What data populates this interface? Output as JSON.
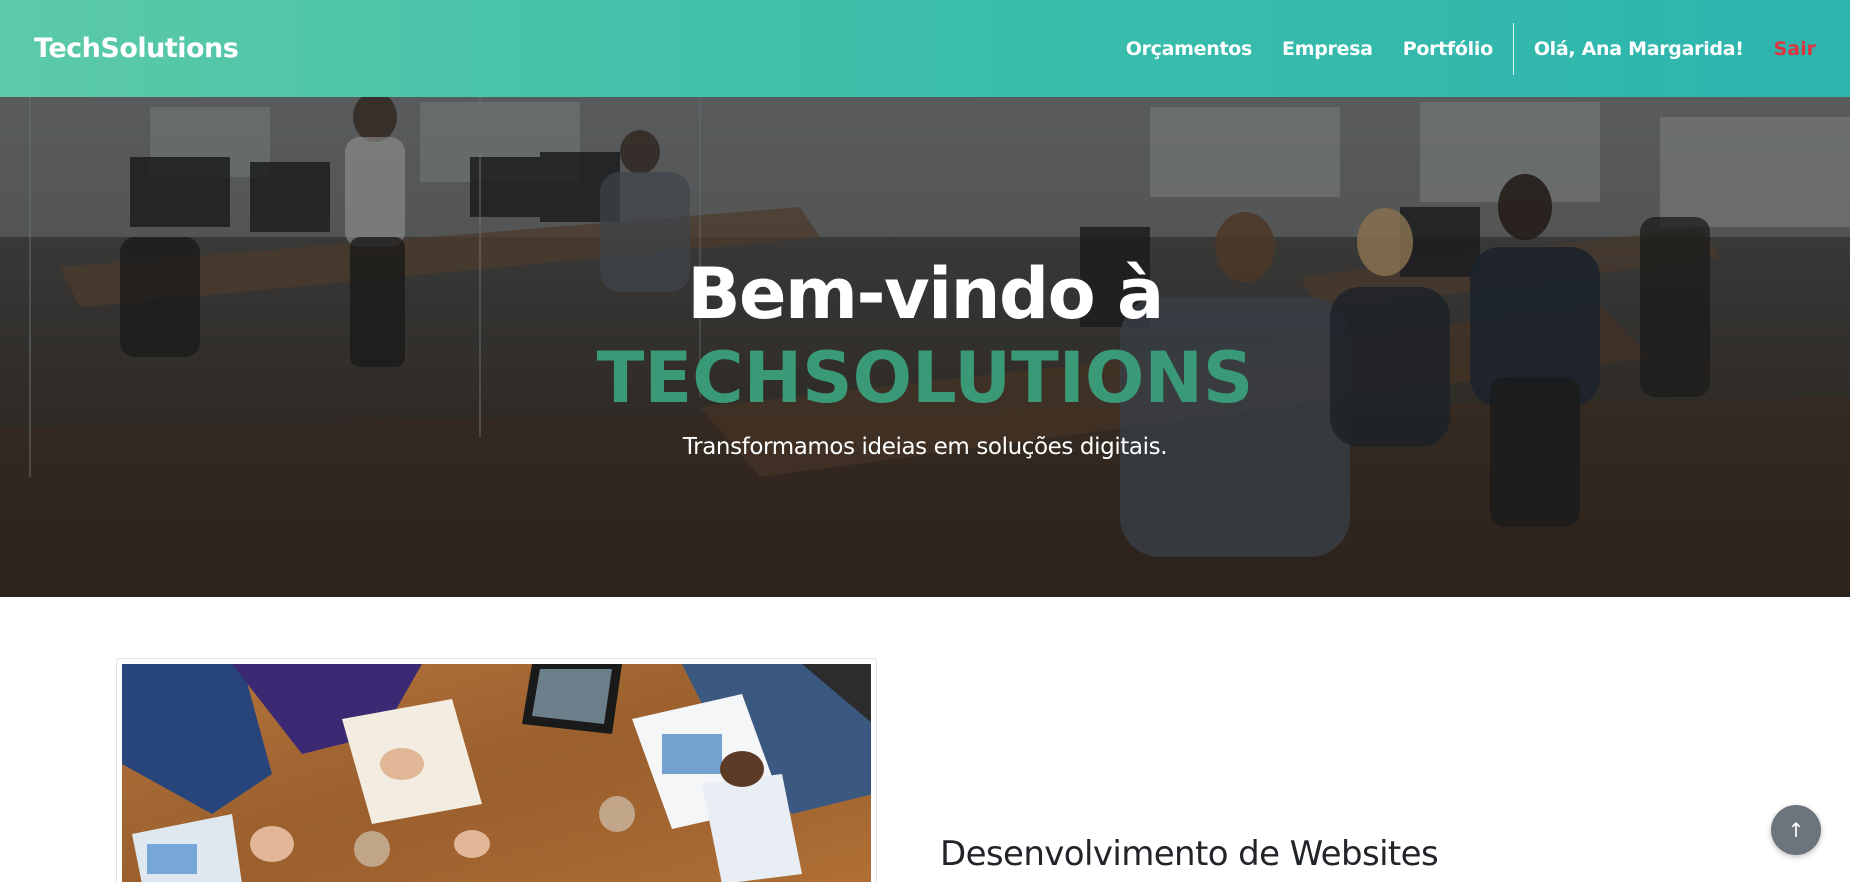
{
  "navbar": {
    "brand": "TechSolutions",
    "links": [
      {
        "label": "Orçamentos"
      },
      {
        "label": "Empresa"
      },
      {
        "label": "Portfólio"
      }
    ],
    "greeting": "Olá, Ana Margarida!",
    "logout": "Sair",
    "logout_color": "#e0323f",
    "gradient": [
      "#5ccaa8",
      "#2db5ae"
    ]
  },
  "hero": {
    "line1": "Bem-vindo à",
    "line2": "TECHSOLUTIONS",
    "line2_color": "#3a9a78",
    "subtitle": "Transformamos ideias em soluções digitais."
  },
  "services": [
    {
      "title": "Desenvolvimento de Websites"
    }
  ],
  "scroll_top": {
    "icon": "arrow-up-icon",
    "glyph": "↑"
  }
}
